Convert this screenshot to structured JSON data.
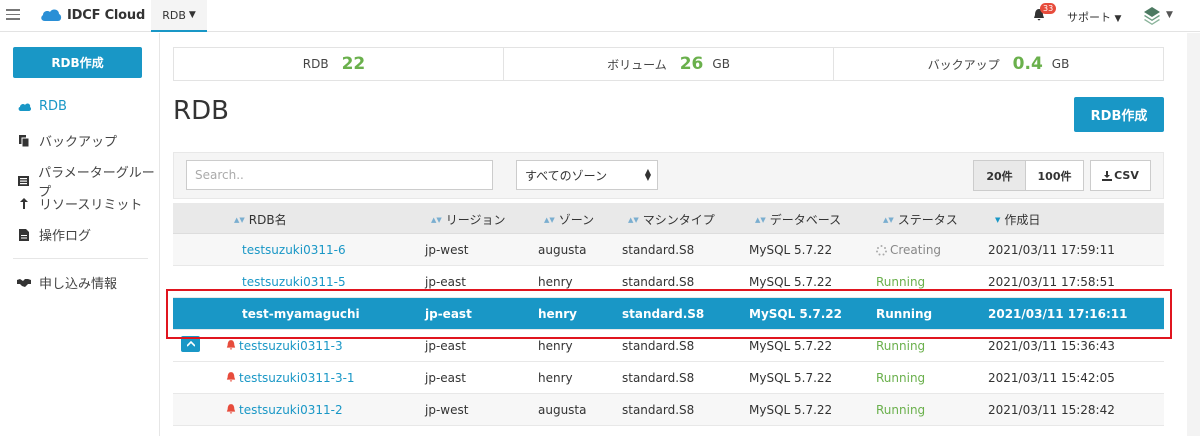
{
  "header": {
    "logo_text": "IDCF Cloud",
    "nav_rdb": "RDB",
    "notification_count": "33",
    "support": "サポート"
  },
  "sidebar": {
    "create_button": "RDB作成",
    "items": [
      {
        "label": "RDB",
        "icon": "cloud-icon"
      },
      {
        "label": "バックアップ",
        "icon": "copy-icon"
      },
      {
        "label": "パラメーターグループ",
        "icon": "list-icon"
      },
      {
        "label": "リソースリミット",
        "icon": "arrow-up-icon"
      },
      {
        "label": "操作ログ",
        "icon": "file-icon"
      },
      {
        "label": "申し込み情報",
        "icon": "handshake-icon"
      }
    ]
  },
  "stats": {
    "rdb_label": "RDB",
    "rdb_value": "22",
    "volume_label": "ボリューム",
    "volume_value": "26",
    "volume_unit": "GB",
    "backup_label": "バックアップ",
    "backup_value": "0.4",
    "backup_unit": "GB"
  },
  "main": {
    "title": "RDB",
    "create_button": "RDB作成"
  },
  "filter": {
    "search_placeholder": "Search..",
    "zone_selected": "すべてのゾーン",
    "btn_20": "20件",
    "btn_100": "100件",
    "btn_csv": "CSV"
  },
  "table": {
    "columns": [
      "RDB名",
      "リージョン",
      "ゾーン",
      "マシンタイプ",
      "データベース",
      "ステータス",
      "作成日"
    ],
    "rows": [
      {
        "name": "testsuzuki0311-6",
        "region": "jp-west",
        "zone": "augusta",
        "type": "standard.S8",
        "db": "MySQL 5.7.22",
        "status": "Creating",
        "created": "2021/03/11 17:59:11"
      },
      {
        "name": "testsuzuki0311-5",
        "region": "jp-east",
        "zone": "henry",
        "type": "standard.S8",
        "db": "MySQL 5.7.22",
        "status": "Running",
        "created": "2021/03/11 17:58:51"
      },
      {
        "name": "test-myamaguchi",
        "region": "jp-east",
        "zone": "henry",
        "type": "standard.S8",
        "db": "MySQL 5.7.22",
        "status": "Running",
        "created": "2021/03/11 17:16:11"
      },
      {
        "name": "testsuzuki0311-3",
        "region": "jp-east",
        "zone": "henry",
        "type": "standard.S8",
        "db": "MySQL 5.7.22",
        "status": "Running",
        "created": "2021/03/11 15:36:43"
      },
      {
        "name": "testsuzuki0311-3-1",
        "region": "jp-east",
        "zone": "henry",
        "type": "standard.S8",
        "db": "MySQL 5.7.22",
        "status": "Running",
        "created": "2021/03/11 15:42:05"
      },
      {
        "name": "testsuzuki0311-2",
        "region": "jp-west",
        "zone": "augusta",
        "type": "standard.S8",
        "db": "MySQL 5.7.22",
        "status": "Running",
        "created": "2021/03/11 15:28:42"
      }
    ]
  },
  "colors": {
    "accent": "#1997c6",
    "running": "#6ab04c",
    "highlight": "#e0151f"
  }
}
